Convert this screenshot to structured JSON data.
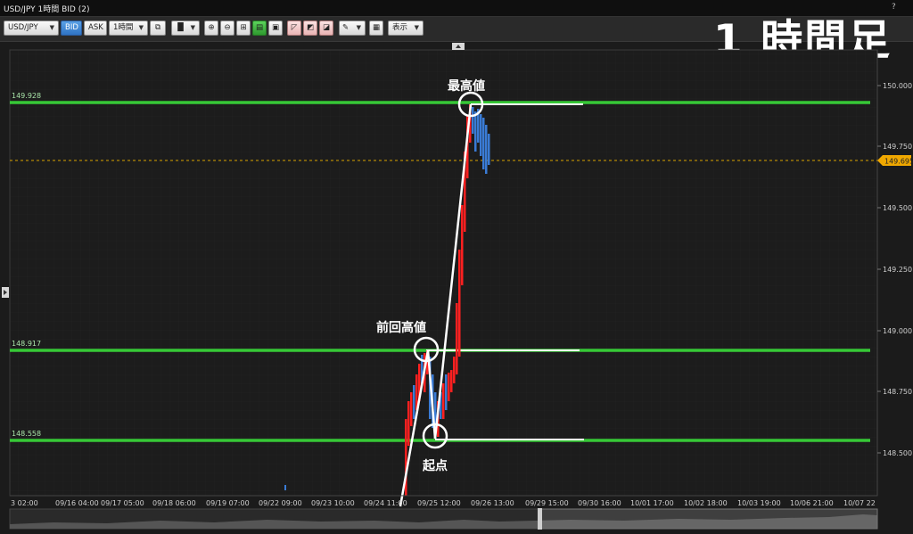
{
  "window": {
    "title": "USD/JPY 1時間 BID (2)",
    "help": "?"
  },
  "overlay_label": "1 時間足",
  "toolbar": {
    "symbol": "USD/JPY",
    "bid_label": "BID",
    "ask_label": "ASK",
    "timeframe": "1時間",
    "display_label": "表示"
  },
  "price_axis": {
    "ticks": [
      "150.000",
      "149.750",
      "149.500",
      "149.250",
      "149.000",
      "148.750",
      "148.500"
    ]
  },
  "current_price": "149.695",
  "horizontal_lines": {
    "top_label": "149.928",
    "mid_label": "148.917",
    "low_label": "148.558"
  },
  "annotations": {
    "top": "最高値",
    "previous_high": "前回高値",
    "start": "起点"
  },
  "time_axis": {
    "ticks": [
      "3 02:00",
      "09/16 04:00",
      "09/17 05:00",
      "09/18 06:00",
      "09/19 07:00",
      "09/22 09:00",
      "09/23 10:00",
      "09/24 11:00",
      "09/25 12:00",
      "09/26 13:00",
      "09/29 15:00",
      "09/30 16:00",
      "10/01 17:00",
      "10/02 18:00",
      "10/03 19:00",
      "10/06 21:00",
      "10/07 22"
    ]
  },
  "colors": {
    "up": "#ff2020",
    "down": "#3a7bd5",
    "level_line": "#2fd02f",
    "current": "#f0a800",
    "background": "#1b1b1b"
  }
}
